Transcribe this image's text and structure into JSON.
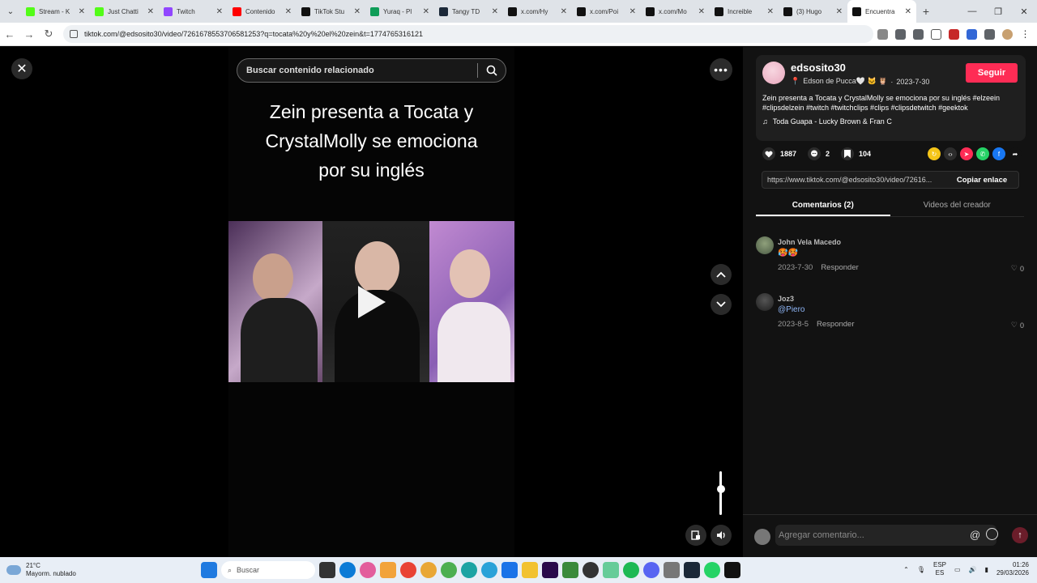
{
  "browser": {
    "tabs": [
      {
        "title": "Stream - K",
        "color": "#53fc18"
      },
      {
        "title": "Just Chatti",
        "color": "#53fc18"
      },
      {
        "title": "Twitch",
        "color": "#9146ff"
      },
      {
        "title": "Contenido",
        "color": "#ff0000"
      },
      {
        "title": "TikTok Stu",
        "color": "#111111"
      },
      {
        "title": "Yuraq - Pl",
        "color": "#0f9d58"
      },
      {
        "title": "Tangy TD",
        "color": "#1b2838"
      },
      {
        "title": "x.com/Hy",
        "color": "#111111"
      },
      {
        "title": "x.com/Poi",
        "color": "#111111"
      },
      {
        "title": "x.com/Mo",
        "color": "#111111"
      },
      {
        "title": "Increible",
        "color": "#111111"
      },
      {
        "title": "(3) Hugo",
        "color": "#111111"
      },
      {
        "title": "Encuentra",
        "color": "#111111"
      }
    ],
    "url": "tiktok.com/@edsosito30/video/7261678553706581253?q=tocata%20y%20el%20zein&t=1774765316121"
  },
  "video": {
    "search_placeholder": "Buscar contenido relacionado",
    "title_lines": [
      "Zein presenta a Tocata y",
      "CrystalMolly se emociona",
      "por su inglés"
    ],
    "volume_level": 0.6
  },
  "creator": {
    "username": "edsosito30",
    "display_name": "Edson de Pucca🤍 🐱 🦉",
    "date": "2023-7-30",
    "follow_label": "Seguir",
    "description": "Zein presenta a Tocata y CrystalMolly se emociona por su inglés #elzeein #clipsdelzein #twitch #twitchclips #clips #clipsdetwitch #geektok",
    "music": "Toda Guapa - Lucky Brown & Fran C"
  },
  "stats": {
    "likes": "1887",
    "comments": "2",
    "saves": "104"
  },
  "link": {
    "url": "https://www.tiktok.com/@edsosito30/video/72616...",
    "copy_label": "Copiar enlace"
  },
  "tabs": {
    "comments": "Comentarios (2)",
    "creator_videos": "Videos del creador"
  },
  "comments": [
    {
      "name": "John Vela Macedo",
      "text": "🥵🥵",
      "date": "2023-7-30",
      "reply": "Responder",
      "likes": "0"
    },
    {
      "name": "Joz3",
      "text": "@Piero",
      "date": "2023-8-5",
      "reply": "Responder",
      "likes": "0"
    }
  ],
  "composer": {
    "placeholder": "Agregar comentario..."
  },
  "taskbar": {
    "temp": "21°C",
    "weather": "Mayorm. nublado",
    "search": "Buscar",
    "lang1": "ESP",
    "lang2": "ES",
    "time": "01:26",
    "date": "29/03/2026"
  }
}
